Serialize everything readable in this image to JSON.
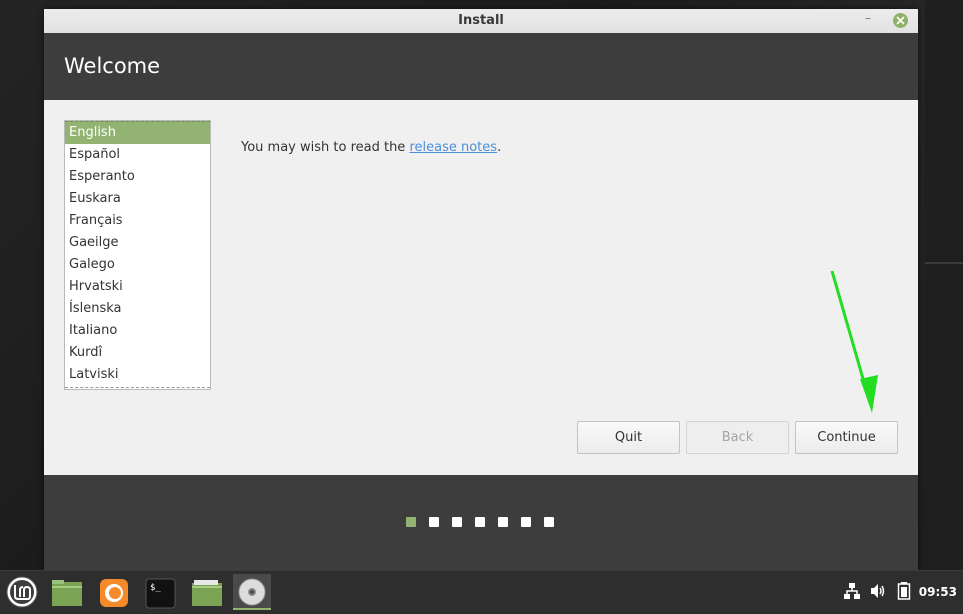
{
  "window": {
    "title": "Install",
    "header_title": "Welcome"
  },
  "languages": {
    "items": [
      "English",
      "Español",
      "Esperanto",
      "Euskara",
      "Français",
      "Gaeilge",
      "Galego",
      "Hrvatski",
      "Íslenska",
      "Italiano",
      "Kurdî",
      "Latviski"
    ],
    "selected": "English"
  },
  "content": {
    "release_prefix": "You may wish to read the ",
    "release_link": "release notes",
    "release_suffix": "."
  },
  "buttons": {
    "quit": "Quit",
    "back": "Back",
    "continue": "Continue"
  },
  "progress": {
    "total_steps": 7,
    "current_step": 1
  },
  "taskbar": {
    "clock": "09:53",
    "apps": [
      "mint-menu-icon",
      "file-manager-icon",
      "firefox-icon",
      "terminal-icon",
      "folder-icon",
      "disc-installer-icon"
    ],
    "tray": [
      "network-icon",
      "volume-icon",
      "battery-icon"
    ]
  },
  "colors": {
    "accent": "#92b372",
    "header": "#3d3d3d",
    "annotation_arrow": "#22dd22"
  }
}
